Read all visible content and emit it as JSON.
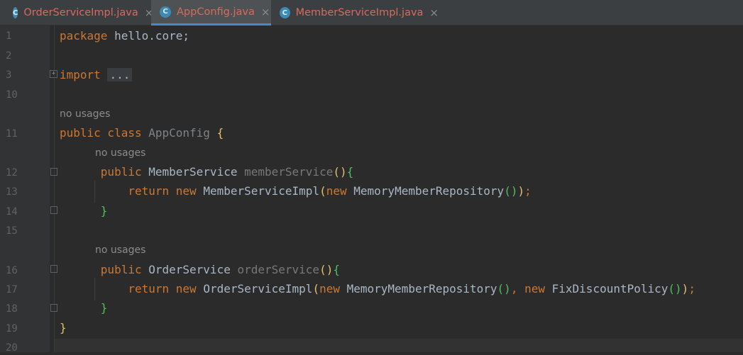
{
  "tabs": [
    {
      "label": "OrderServiceImpl.java",
      "icon": "C"
    },
    {
      "label": "AppConfig.java",
      "icon": "C"
    },
    {
      "label": "MemberServiceImpl.java",
      "icon": "C"
    }
  ],
  "tab_close_glyph": "×",
  "line_numbers": [
    "1",
    "2",
    "3",
    "10",
    "11",
    "12",
    "13",
    "14",
    "15",
    "16",
    "17",
    "18",
    "19",
    "20"
  ],
  "hints": {
    "no_usages": "no usages"
  },
  "code": {
    "l1_kw": "package",
    "l1_rest": " hello.core;",
    "l3_kw": "import",
    "l3_fold": "...",
    "l11_kw": "public class",
    "l11_name": "AppConfig",
    "l11_brace": "{",
    "l12_kw": "public",
    "l12_type": "MemberService",
    "l12_name": "memberService",
    "l12_paren": "()",
    "l12_brace": "{",
    "l13_return": "return",
    "l13_new1": "new",
    "l13_class": "MemberServiceImpl",
    "l13_open": "(",
    "l13_new2": "new",
    "l13_arg": "MemoryMemberRepository",
    "l13_argparen": "()",
    "l13_close": ")",
    "l13_semi": ";",
    "l14_brace": "}",
    "l16_kw": "public",
    "l16_type": "OrderService",
    "l16_name": "orderService",
    "l16_paren": "()",
    "l16_brace": "{",
    "l17_return": "return",
    "l17_new1": "new",
    "l17_class": "OrderServiceImpl",
    "l17_open": "(",
    "l17_new2": "new",
    "l17_arg1": "MemoryMemberRepository",
    "l17_arg1paren": "()",
    "l17_comma": ",",
    "l17_new3": "new",
    "l17_arg2": "FixDiscountPolicy",
    "l17_arg2paren": "()",
    "l17_close": ")",
    "l17_semi": ";",
    "l18_brace": "}",
    "l19_brace": "}"
  }
}
